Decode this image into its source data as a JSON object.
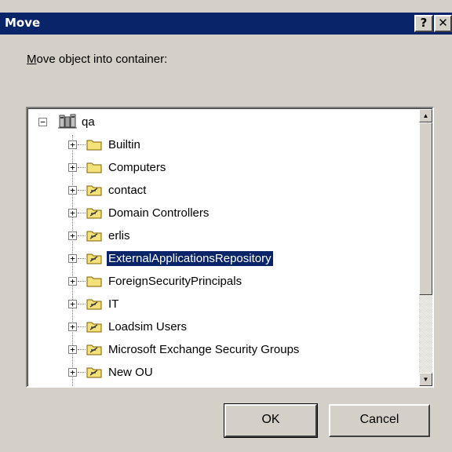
{
  "window": {
    "title": "Move",
    "help_label": "?",
    "close_label": "✕"
  },
  "instruction": {
    "accel": "M",
    "rest": "ove object into container:"
  },
  "tree": {
    "root": {
      "label": "qa",
      "expander": "−",
      "icon": "domain-icon"
    },
    "items": [
      {
        "label": "Builtin",
        "expander": "+",
        "icon": "folder-icon"
      },
      {
        "label": "Computers",
        "expander": "+",
        "icon": "folder-icon"
      },
      {
        "label": "contact",
        "expander": "+",
        "icon": "ou-folder-icon"
      },
      {
        "label": "Domain Controllers",
        "expander": "+",
        "icon": "ou-folder-icon"
      },
      {
        "label": "erlis",
        "expander": "+",
        "icon": "ou-folder-icon"
      },
      {
        "label": "ExternalApplicationsRepository",
        "expander": "+",
        "icon": "ou-folder-icon",
        "selected": true
      },
      {
        "label": "ForeignSecurityPrincipals",
        "expander": "+",
        "icon": "folder-icon"
      },
      {
        "label": "IT",
        "expander": "+",
        "icon": "ou-folder-icon"
      },
      {
        "label": "Loadsim Users",
        "expander": "+",
        "icon": "ou-folder-icon"
      },
      {
        "label": "Microsoft Exchange Security Groups",
        "expander": "+",
        "icon": "ou-folder-icon"
      },
      {
        "label": "New OU",
        "expander": "+",
        "icon": "ou-folder-icon"
      }
    ]
  },
  "scrollbar": {
    "up_arrow": "▲",
    "down_arrow": "▼"
  },
  "buttons": {
    "ok_label": "OK",
    "cancel_label": "Cancel"
  },
  "colors": {
    "selection": "#0a246a",
    "titlebar": "#0a246a",
    "face": "#d4d0c8",
    "folder": "#f4e17a"
  }
}
